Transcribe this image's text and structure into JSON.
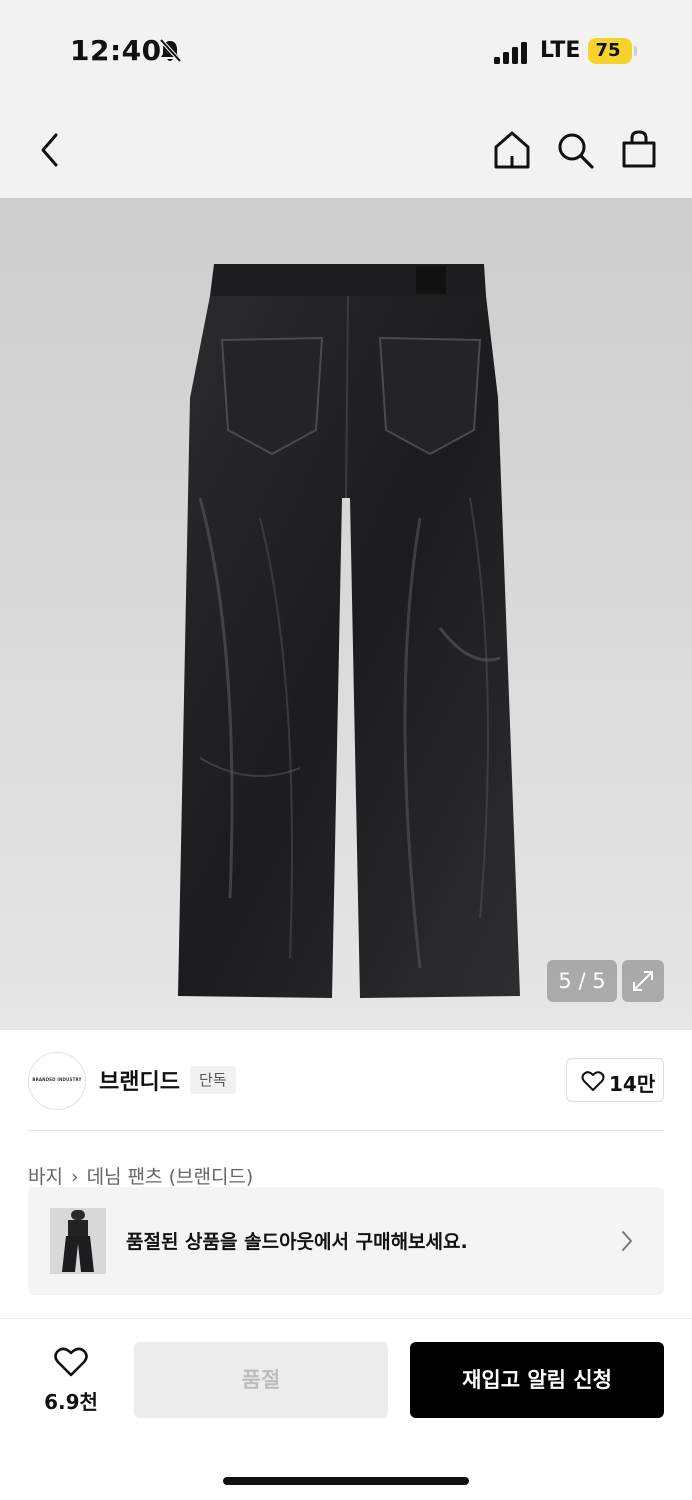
{
  "status_bar": {
    "time": "12:40",
    "network": "LTE",
    "battery": "75",
    "icons": [
      "bell-slash-icon",
      "signal-icon",
      "battery-icon"
    ]
  },
  "nav": {
    "icons": [
      "back-icon",
      "home-icon",
      "search-icon",
      "shopping-bag-icon"
    ]
  },
  "gallery": {
    "pager": "5 / 5",
    "expand_icon": "expand-icon"
  },
  "brand": {
    "logo_text": "BRANDED INDUSTRY",
    "name": "브랜디드",
    "tag": "단독",
    "like_count": "14만"
  },
  "breadcrumb": {
    "category": "바지",
    "sub": "데님 팬츠 (브랜디드)"
  },
  "banner": {
    "text": "품절된 상품을 솔드아웃에서 구매해보세요."
  },
  "bottom_bar": {
    "wish_count": "6.9천",
    "soldout_label": "품절",
    "restock_label": "재입고 알림 신청"
  },
  "colors": {
    "accent": "#000000",
    "battery": "#f5d32a",
    "background_top": "#f2f2f2",
    "disabled": "#ececec"
  }
}
